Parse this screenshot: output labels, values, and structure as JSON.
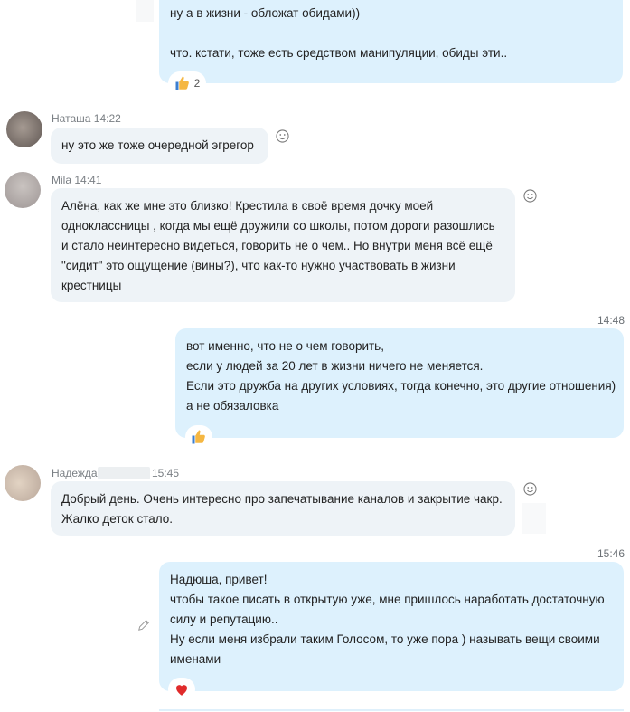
{
  "messages": {
    "m1": {
      "lines": "ну а в жизни - обложат обидами))\n\nчто. кстати, тоже есть средством манипуляции, обиды эти..",
      "reaction_count": "2"
    },
    "m2": {
      "author": "Наташа",
      "time": "14:22",
      "text": "ну это же тоже очередной эгрегор"
    },
    "m3": {
      "author": "Mila",
      "time": "14:41",
      "text": "Алёна, как же мне это близко! Крестила в своё время дочку моей\nодноклассницы , когда мы ещё дружили со школы, потом дороги разошлись\nи стало неинтересно видеться, говорить не о чем.. Но внутри меня всё ещё\n\"сидит\" это ощущение (вины?), что как-то нужно участвовать в жизни\nкрестницы"
    },
    "m4": {
      "time": "14:48",
      "text": "вот именно, что не о чем говорить,\nесли у людей за 20 лет в жизни ничего не меняется.\nЕсли это дружба на других условиях, тогда конечно, это другие отношения)\nа не обязаловка"
    },
    "m5": {
      "author": "Надежда",
      "time": "15:45",
      "text": "Добрый день. Очень интересно про запечатывание каналов и закрытие чакр.\nЖалко деток стало."
    },
    "m6": {
      "time": "15:46",
      "text": "Надюша, привет!\nчтобы такое писать в открытую уже, мне пришлось наработать достаточную\nсилу и репутацию..\nНу если меня избрали таким Голосом, то уже пора ) называть вещи своими\nименами"
    }
  },
  "icons": {
    "smile": "smile-icon",
    "thumbs": "thumbs-up-icon",
    "heart": "heart-icon",
    "pencil": "pencil-icon"
  },
  "colors": {
    "outgoing": "#ddf1fd",
    "incoming": "#eef3f7",
    "heart": "#e02b2b",
    "thumb": "#f5b742"
  }
}
